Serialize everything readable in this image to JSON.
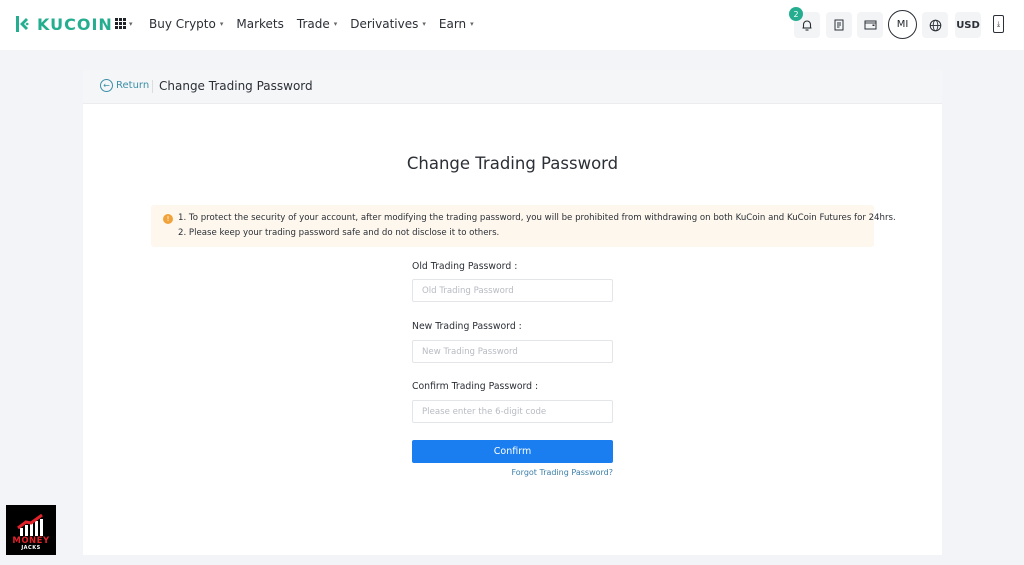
{
  "brand": {
    "name": "KUCOIN",
    "accent_color": "#24ae8f"
  },
  "nav": {
    "apps_icon": "grid-apps-icon",
    "links": [
      {
        "label": "Buy Crypto",
        "has_dropdown": true
      },
      {
        "label": "Markets",
        "has_dropdown": false
      },
      {
        "label": "Trade",
        "has_dropdown": true
      },
      {
        "label": "Derivatives",
        "has_dropdown": true
      },
      {
        "label": "Earn",
        "has_dropdown": true
      }
    ],
    "notification_count": "2",
    "avatar_initials": "MI",
    "currency": "USD"
  },
  "card": {
    "return_label": "Return",
    "breadcrumb_title": "Change Trading Password",
    "page_title": "Change Trading Password",
    "notice": {
      "line1": "1. To protect the security of your account, after modifying the trading password, you will be prohibited from withdrawing on both KuCoin and KuCoin Futures for 24hrs.",
      "line2": "2. Please keep your trading password safe and do not disclose it to others.",
      "icon_color": "#f0a33a",
      "background": "#fdf7ee"
    },
    "fields": [
      {
        "label": "Old Trading Password :",
        "placeholder": "Old Trading Password",
        "value": ""
      },
      {
        "label": "New Trading Password :",
        "placeholder": "New Trading Password",
        "value": ""
      },
      {
        "label": "Confirm Trading Password :",
        "placeholder": "Please enter the 6-digit code",
        "value": ""
      }
    ],
    "confirm_label": "Confirm",
    "confirm_color": "#1a7ef0",
    "forgot_label": "Forgot Trading Password?"
  },
  "watermark": {
    "line1": "MONEY",
    "line2": "JACKS"
  }
}
